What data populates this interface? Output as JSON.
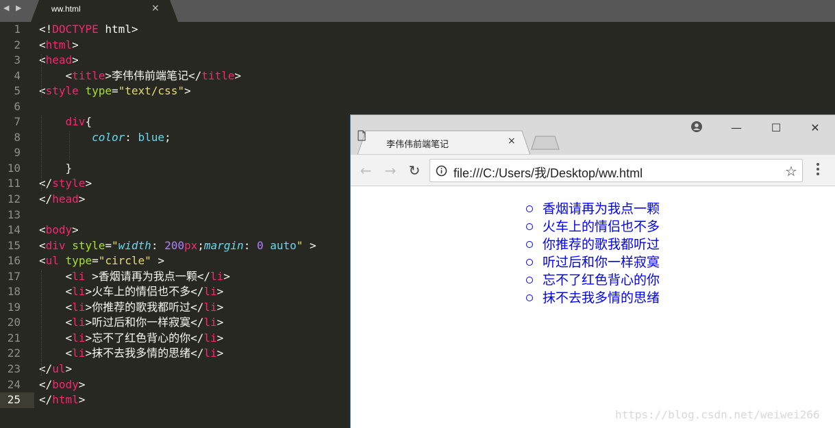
{
  "editor": {
    "tab_label": "ww.html",
    "nav_back": "◀",
    "nav_forward": "▶",
    "tab_close": "×",
    "active_line": 25,
    "lines": [
      {
        "n": "1",
        "tokens": [
          [
            "pl",
            "<!"
          ],
          [
            "tag",
            "DOCTYPE"
          ],
          [
            "pl",
            " html>"
          ]
        ]
      },
      {
        "n": "2",
        "tokens": [
          [
            "pl",
            "<"
          ],
          [
            "tag",
            "html"
          ],
          [
            "pl",
            ">"
          ]
        ]
      },
      {
        "n": "3",
        "tokens": [
          [
            "pl",
            "<"
          ],
          [
            "tag",
            "head"
          ],
          [
            "pl",
            ">"
          ]
        ]
      },
      {
        "n": "4",
        "tokens": [
          [
            "pl",
            "    <"
          ],
          [
            "tag",
            "title"
          ],
          [
            "pl",
            ">李伟伟前端笔记</"
          ],
          [
            "tag",
            "title"
          ],
          [
            "pl",
            ">"
          ]
        ]
      },
      {
        "n": "5",
        "tokens": [
          [
            "pl",
            "<"
          ],
          [
            "tag",
            "style"
          ],
          [
            "pl",
            " "
          ],
          [
            "attr",
            "type"
          ],
          [
            "pl",
            "="
          ],
          [
            "str",
            "\"text/css\""
          ],
          [
            "pl",
            ">"
          ]
        ]
      },
      {
        "n": "6",
        "tokens": []
      },
      {
        "n": "7",
        "tokens": [
          [
            "pl",
            "    "
          ],
          [
            "tag",
            "div"
          ],
          [
            "pl",
            "{"
          ]
        ]
      },
      {
        "n": "8",
        "tokens": [
          [
            "pl",
            "        "
          ],
          [
            "prop",
            "color"
          ],
          [
            "pl",
            ": "
          ],
          [
            "kw",
            "blue"
          ],
          [
            "pl",
            ";"
          ]
        ]
      },
      {
        "n": "9",
        "tokens": []
      },
      {
        "n": "10",
        "tokens": [
          [
            "pl",
            "    }"
          ]
        ]
      },
      {
        "n": "11",
        "tokens": [
          [
            "pl",
            "</"
          ],
          [
            "tag",
            "style"
          ],
          [
            "pl",
            ">"
          ]
        ]
      },
      {
        "n": "12",
        "tokens": [
          [
            "pl",
            "</"
          ],
          [
            "tag",
            "head"
          ],
          [
            "pl",
            ">"
          ]
        ]
      },
      {
        "n": "13",
        "tokens": []
      },
      {
        "n": "14",
        "tokens": [
          [
            "pl",
            "<"
          ],
          [
            "tag",
            "body"
          ],
          [
            "pl",
            ">"
          ]
        ]
      },
      {
        "n": "15",
        "tokens": [
          [
            "pl",
            "<"
          ],
          [
            "tag",
            "div"
          ],
          [
            "pl",
            " "
          ],
          [
            "attr",
            "style"
          ],
          [
            "pl",
            "="
          ],
          [
            "str",
            "\""
          ],
          [
            "prop",
            "width"
          ],
          [
            "pl",
            ": "
          ],
          [
            "num",
            "200"
          ],
          [
            "tag",
            "px"
          ],
          [
            "pl",
            ";"
          ],
          [
            "prop",
            "margin"
          ],
          [
            "pl",
            ": "
          ],
          [
            "num",
            "0"
          ],
          [
            "pl",
            " "
          ],
          [
            "kw",
            "auto"
          ],
          [
            "str",
            "\""
          ],
          [
            "pl",
            " >"
          ]
        ]
      },
      {
        "n": "16",
        "tokens": [
          [
            "pl",
            "<"
          ],
          [
            "tag",
            "ul"
          ],
          [
            "pl",
            " "
          ],
          [
            "attr",
            "type"
          ],
          [
            "pl",
            "="
          ],
          [
            "str",
            "\"circle\""
          ],
          [
            "pl",
            " >"
          ]
        ]
      },
      {
        "n": "17",
        "tokens": [
          [
            "pl",
            "    <"
          ],
          [
            "tag",
            "li"
          ],
          [
            "pl",
            " >香烟请再为我点一颗</"
          ],
          [
            "tag",
            "li"
          ],
          [
            "pl",
            ">"
          ]
        ]
      },
      {
        "n": "18",
        "tokens": [
          [
            "pl",
            "    <"
          ],
          [
            "tag",
            "li"
          ],
          [
            "pl",
            ">火车上的情侣也不多</"
          ],
          [
            "tag",
            "li"
          ],
          [
            "pl",
            ">"
          ]
        ]
      },
      {
        "n": "19",
        "tokens": [
          [
            "pl",
            "    <"
          ],
          [
            "tag",
            "li"
          ],
          [
            "pl",
            ">你推荐的歌我都听过</"
          ],
          [
            "tag",
            "li"
          ],
          [
            "pl",
            ">"
          ]
        ]
      },
      {
        "n": "20",
        "tokens": [
          [
            "pl",
            "    <"
          ],
          [
            "tag",
            "li"
          ],
          [
            "pl",
            ">听过后和你一样寂寞</"
          ],
          [
            "tag",
            "li"
          ],
          [
            "pl",
            ">"
          ]
        ]
      },
      {
        "n": "21",
        "tokens": [
          [
            "pl",
            "    <"
          ],
          [
            "tag",
            "li"
          ],
          [
            "pl",
            ">忘不了红色背心的你</"
          ],
          [
            "tag",
            "li"
          ],
          [
            "pl",
            ">"
          ]
        ]
      },
      {
        "n": "22",
        "tokens": [
          [
            "pl",
            "    <"
          ],
          [
            "tag",
            "li"
          ],
          [
            "pl",
            ">抹不去我多情的思绪</"
          ],
          [
            "tag",
            "li"
          ],
          [
            "pl",
            ">"
          ]
        ]
      },
      {
        "n": "23",
        "tokens": [
          [
            "pl",
            "</"
          ],
          [
            "tag",
            "ul"
          ],
          [
            "pl",
            ">"
          ]
        ]
      },
      {
        "n": "24",
        "tokens": [
          [
            "pl",
            "</"
          ],
          [
            "tag",
            "body"
          ],
          [
            "pl",
            ">"
          ]
        ]
      },
      {
        "n": "25",
        "tokens": [
          [
            "pl",
            "</"
          ],
          [
            "tag",
            "html"
          ],
          [
            "pl",
            ">"
          ]
        ]
      }
    ]
  },
  "browser": {
    "tab_title": "李伟伟前端笔记",
    "tab_close": "×",
    "url": "file:///C:/Users/我/Desktop/ww.html",
    "icons": {
      "back": "arrow-left-icon",
      "forward": "arrow-right-icon",
      "reload": "reload-icon",
      "info": "info-icon",
      "star": "star-icon",
      "menu": "kebab-menu-icon",
      "profile": "profile-icon",
      "minimize": "minimize-icon",
      "maximize": "maximize-icon",
      "close": "close-icon"
    },
    "glyphs": {
      "back": "←",
      "forward": "→",
      "reload": "↻",
      "star": "☆",
      "minimize": "—",
      "maximize": "☐",
      "close": "✕"
    },
    "list_items": [
      "香烟请再为我点一颗",
      "火车上的情侣也不多",
      "你推荐的歌我都听过",
      "听过后和你一样寂寞",
      "忘不了红色背心的你",
      "抹不去我多情的思绪"
    ],
    "list_color": "#0000ff"
  },
  "watermark": "https://blog.csdn.net/weiwei266",
  "colors": {
    "editor_bg": "#272822",
    "tag": "#f92672",
    "attr": "#a6e22e",
    "string": "#e6db74",
    "property": "#66d9ef",
    "number": "#ae81ff"
  }
}
